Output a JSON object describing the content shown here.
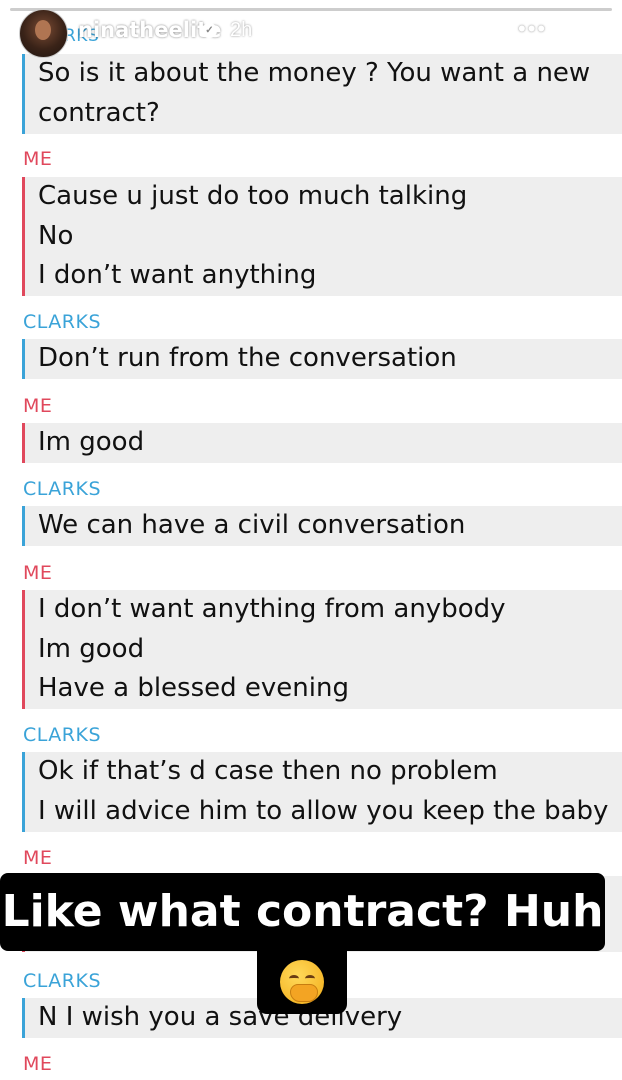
{
  "story": {
    "username": "ninatheelite",
    "time": "2h",
    "more_label": "•••",
    "partial_header_sender": "RKS"
  },
  "conversation": [
    {
      "sender": "",
      "who": "clarks",
      "lines": [
        "So is it about the money ? You want a new",
        "contract?"
      ]
    },
    {
      "sender": "ME",
      "who": "me",
      "lines": [
        "Cause u just do too much talking",
        "No",
        "I don’t want anything"
      ]
    },
    {
      "sender": "CLARKS",
      "who": "clarks",
      "lines": [
        "Don’t run from the conversation"
      ]
    },
    {
      "sender": "ME",
      "who": "me",
      "lines": [
        "Im good"
      ]
    },
    {
      "sender": "CLARKS",
      "who": "clarks",
      "lines": [
        "We can have a civil conversation"
      ]
    },
    {
      "sender": "ME",
      "who": "me",
      "lines": [
        "I don’t want anything from anybody",
        "Im good",
        "Have a blessed evening"
      ]
    },
    {
      "sender": "CLARKS",
      "who": "clarks",
      "lines": [
        "Ok if that’s d case then no problem",
        "I will advice him to allow you keep the baby"
      ]
    },
    {
      "sender": "ME",
      "who": "me",
      "lines": [
        ""
      ]
    },
    {
      "sender": "CLARKS",
      "who": "clarks",
      "lines": [
        "N I wish you a save delivery"
      ]
    },
    {
      "sender": "ME",
      "who": "me",
      "lines": []
    }
  ],
  "overlay": {
    "caption": "Like what contract? Huh",
    "emoji_icon": "yawning-face-icon"
  },
  "colors": {
    "clarks": "#3aa3d8",
    "me": "#e0485c",
    "bubble": "#eeeeee",
    "caption_bg": "#000000"
  }
}
